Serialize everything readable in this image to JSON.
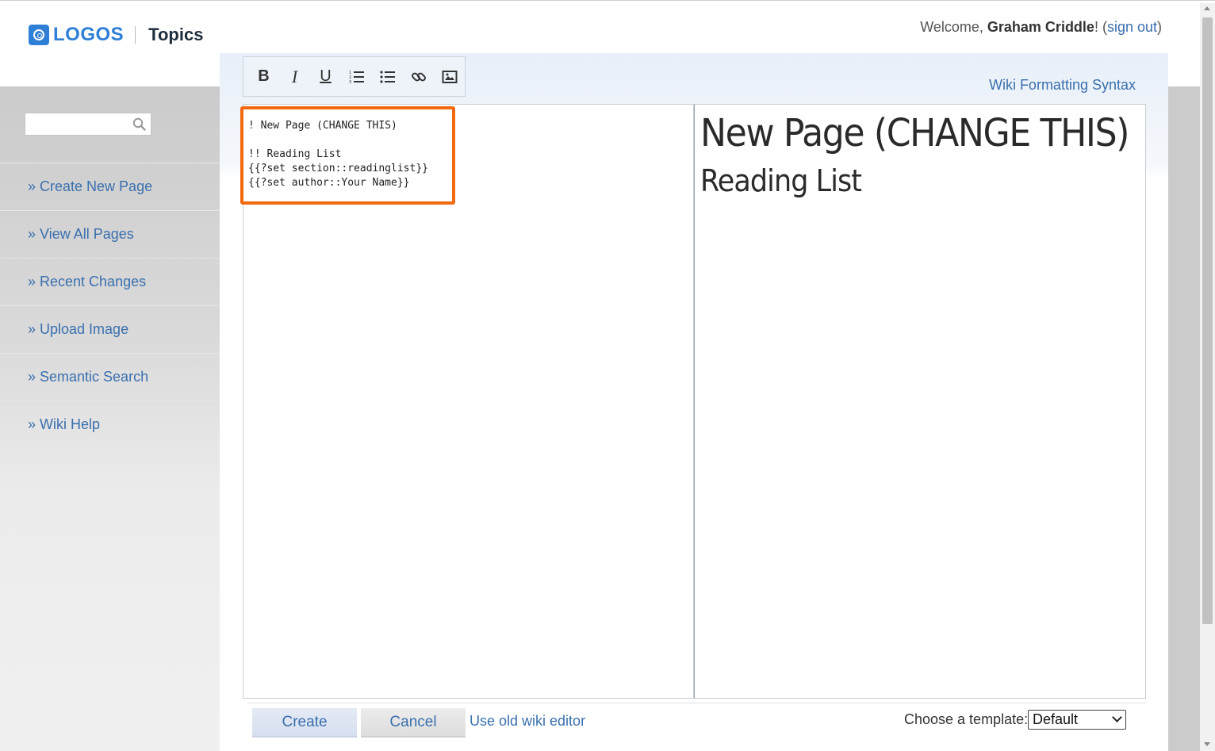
{
  "header": {
    "logo_text": "LOGOS",
    "product": "Topics",
    "welcome_prefix": "Welcome, ",
    "user_name": "Graham Criddle",
    "welcome_mid": "! (",
    "sign_out": "sign out",
    "welcome_suffix": ")"
  },
  "sidebar": {
    "search_placeholder": "",
    "items": [
      {
        "label": "» Create New Page"
      },
      {
        "label": "» View All Pages"
      },
      {
        "label": "» Recent Changes"
      },
      {
        "label": "» Upload Image"
      },
      {
        "label": "» Semantic Search"
      },
      {
        "label": "» Wiki Help"
      }
    ]
  },
  "toolbar": {
    "bold": "B",
    "italic": "I",
    "underline": "U",
    "icons": [
      "bold-icon",
      "italic-icon",
      "underline-icon",
      "ordered-list-icon",
      "bullet-list-icon",
      "link-icon",
      "image-icon"
    ]
  },
  "wiki_syntax_link": "Wiki Formatting Syntax",
  "editor": {
    "lines": [
      "! New Page (CHANGE THIS)",
      "",
      "!! Reading List",
      "{{?set section::readinglist}}",
      "{{?set author::Your Name}}"
    ]
  },
  "preview": {
    "h1": "New Page (CHANGE THIS)",
    "h2": "Reading List"
  },
  "footer": {
    "create": "Create",
    "cancel": "Cancel",
    "old_editor": "Use old wiki editor",
    "template_label": "Choose a template:",
    "template_value": "Default"
  },
  "colors": {
    "link": "#3a6fae",
    "highlight": "#f26a10",
    "logo_blue": "#2f7fd6"
  }
}
